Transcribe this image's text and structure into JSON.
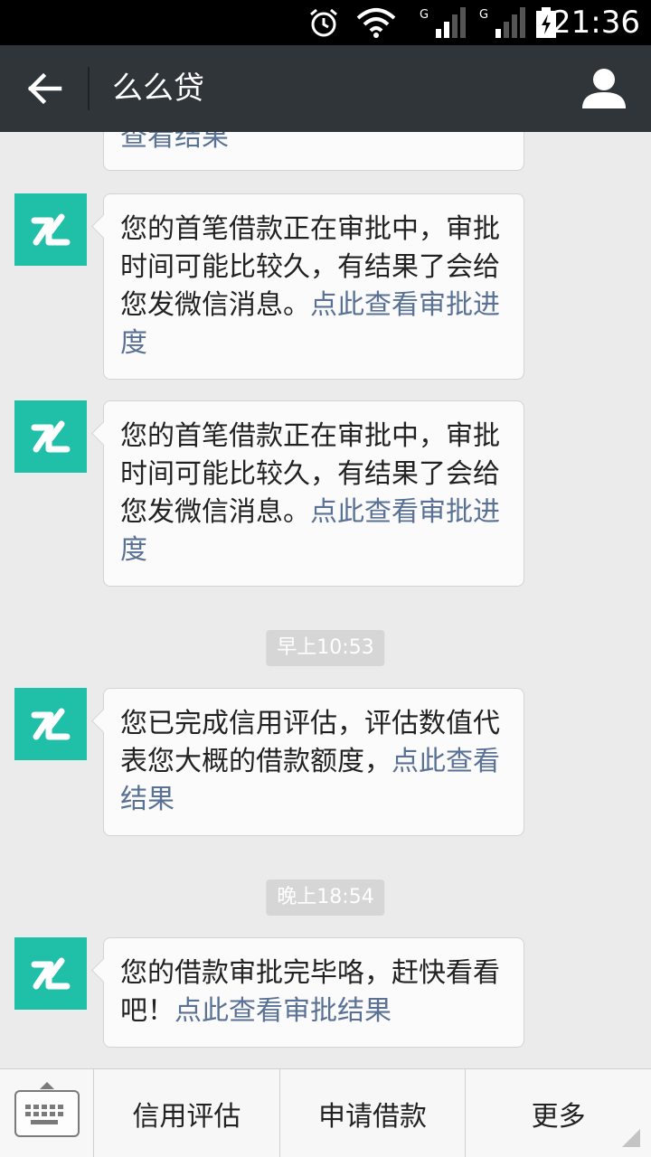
{
  "status_bar": {
    "time": "21:36",
    "network_1": "G",
    "network_2": "G",
    "icons": [
      "alarm-icon",
      "wifi-icon",
      "signal-icon",
      "signal-icon",
      "battery-charging-icon"
    ]
  },
  "header": {
    "title": "么么贷",
    "back_icon": "arrow-left-icon",
    "profile_icon": "person-icon"
  },
  "chat": {
    "partial_message": {
      "link": "查看结果"
    },
    "messages": [
      {
        "text": "您的首笔借款正在审批中，审批时间可能比较久，有结果了会给您发微信消息。",
        "link": "点此查看审批进度"
      },
      {
        "text": "您的首笔借款正在审批中，审批时间可能比较久，有结果了会给您发微信消息。",
        "link": "点此查看审批进度"
      },
      {
        "text": "您已完成信用评估，评估数值代表您大概的借款额度，",
        "link": "点此查看结果"
      },
      {
        "text": "您的借款审批完毕咯，赶快看看吧！",
        "link": "点此查看审批结果"
      }
    ],
    "timestamps": [
      "早上10:53",
      "晚上18:54"
    ]
  },
  "bottom_menu": {
    "items": [
      "信用评估",
      "申请借款",
      "更多"
    ]
  },
  "colors": {
    "avatar_bg": "#1fbfa8",
    "link": "#5a7196",
    "title_bar": "#2f3538"
  }
}
